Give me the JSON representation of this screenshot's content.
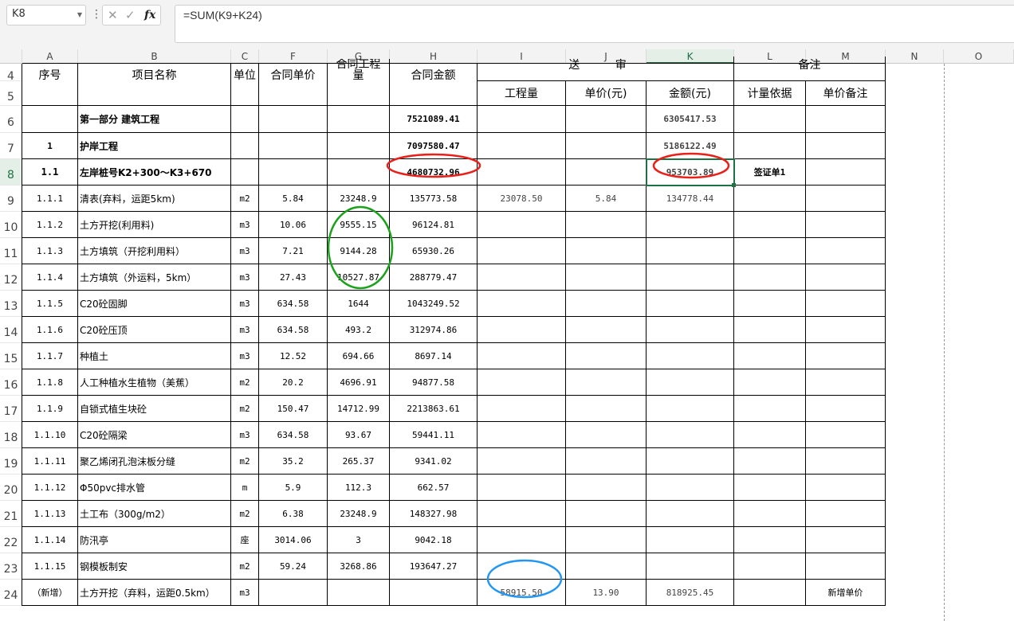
{
  "name_box": "K8",
  "formula": "=SUM(K9+K24)",
  "columns": [
    "A",
    "B",
    "C",
    "F",
    "G",
    "H",
    "I",
    "J",
    "K",
    "L",
    "M",
    "N",
    "O"
  ],
  "row_numbers": [
    "4",
    "5",
    "6",
    "7",
    "8",
    "9",
    "10",
    "11",
    "12",
    "13",
    "14",
    "15",
    "16",
    "17",
    "18",
    "19",
    "20",
    "21",
    "22",
    "23",
    "24"
  ],
  "header": {
    "seq": "序号",
    "name": "项目名称",
    "unit": "单位",
    "contract_price": "合同单价",
    "contract_qty": "合同工程量",
    "contract_amount": "合同金额",
    "group_mid": "送 审",
    "group_note": "备注",
    "qty": "工程量",
    "price": "单价(元)",
    "amount": "金额(元)",
    "basis": "计量依据",
    "price_note": "单价备注"
  },
  "rows": [
    {
      "seq": "",
      "name": "第一部分 建筑工程",
      "unit": "",
      "f": "",
      "g": "",
      "h": "7521089.41",
      "i": "",
      "j": "",
      "k": "6305417.53",
      "l": "",
      "m": ""
    },
    {
      "seq": "1",
      "name": "护岸工程",
      "unit": "",
      "f": "",
      "g": "",
      "h": "7097580.47",
      "i": "",
      "j": "",
      "k": "5186122.49",
      "l": "",
      "m": ""
    },
    {
      "seq": "1.1",
      "name": "左岸桩号K2+300～K3+670",
      "unit": "",
      "f": "",
      "g": "",
      "h": "4680732.96",
      "i": "",
      "j": "",
      "k": "953703.89",
      "l": "签证单1",
      "m": ""
    },
    {
      "seq": "1.1.1",
      "name": "清表(弃料，运距5km)",
      "unit": "m2",
      "f": "5.84",
      "g": "23248.9",
      "h": "135773.58",
      "i": "23078.50",
      "j": "5.84",
      "k": "134778.44",
      "l": "",
      "m": ""
    },
    {
      "seq": "1.1.2",
      "name": "土方开挖(利用料)",
      "unit": "m3",
      "f": "10.06",
      "g": "9555.15",
      "h": "96124.81",
      "i": "",
      "j": "",
      "k": "",
      "l": "",
      "m": ""
    },
    {
      "seq": "1.1.3",
      "name": "土方填筑（开挖利用料）",
      "unit": "m3",
      "f": "7.21",
      "g": "9144.28",
      "h": "65930.26",
      "i": "",
      "j": "",
      "k": "",
      "l": "",
      "m": ""
    },
    {
      "seq": "1.1.4",
      "name": "土方填筑（外运料，5km）",
      "unit": "m3",
      "f": "27.43",
      "g": "10527.87",
      "h": "288779.47",
      "i": "",
      "j": "",
      "k": "",
      "l": "",
      "m": ""
    },
    {
      "seq": "1.1.5",
      "name": "C20砼固脚",
      "unit": "m3",
      "f": "634.58",
      "g": "1644",
      "h": "1043249.52",
      "i": "",
      "j": "",
      "k": "",
      "l": "",
      "m": ""
    },
    {
      "seq": "1.1.6",
      "name": "C20砼压顶",
      "unit": "m3",
      "f": "634.58",
      "g": "493.2",
      "h": "312974.86",
      "i": "",
      "j": "",
      "k": "",
      "l": "",
      "m": ""
    },
    {
      "seq": "1.1.7",
      "name": "种植土",
      "unit": "m3",
      "f": "12.52",
      "g": "694.66",
      "h": "8697.14",
      "i": "",
      "j": "",
      "k": "",
      "l": "",
      "m": ""
    },
    {
      "seq": "1.1.8",
      "name": "人工种植水生植物（美蕉）",
      "unit": "m2",
      "f": "20.2",
      "g": "4696.91",
      "h": "94877.58",
      "i": "",
      "j": "",
      "k": "",
      "l": "",
      "m": ""
    },
    {
      "seq": "1.1.9",
      "name": "自锁式植生块砼",
      "unit": "m2",
      "f": "150.47",
      "g": "14712.99",
      "h": "2213863.61",
      "i": "",
      "j": "",
      "k": "",
      "l": "",
      "m": ""
    },
    {
      "seq": "1.1.10",
      "name": "C20砼隔梁",
      "unit": "m3",
      "f": "634.58",
      "g": "93.67",
      "h": "59441.11",
      "i": "",
      "j": "",
      "k": "",
      "l": "",
      "m": ""
    },
    {
      "seq": "1.1.11",
      "name": "聚乙烯闭孔泡沫板分缝",
      "unit": "m2",
      "f": "35.2",
      "g": "265.37",
      "h": "9341.02",
      "i": "",
      "j": "",
      "k": "",
      "l": "",
      "m": ""
    },
    {
      "seq": "1.1.12",
      "name": "Φ50pvc排水管",
      "unit": "m",
      "f": "5.9",
      "g": "112.3",
      "h": "662.57",
      "i": "",
      "j": "",
      "k": "",
      "l": "",
      "m": ""
    },
    {
      "seq": "1.1.13",
      "name": "土工布（300g/m2）",
      "unit": "m2",
      "f": "6.38",
      "g": "23248.9",
      "h": "148327.98",
      "i": "",
      "j": "",
      "k": "",
      "l": "",
      "m": ""
    },
    {
      "seq": "1.1.14",
      "name": "防汛亭",
      "unit": "座",
      "f": "3014.06",
      "g": "3",
      "h": "9042.18",
      "i": "",
      "j": "",
      "k": "",
      "l": "",
      "m": ""
    },
    {
      "seq": "1.1.15",
      "name": "钢模板制安",
      "unit": "m2",
      "f": "59.24",
      "g": "3268.86",
      "h": "193647.27",
      "i": "",
      "j": "",
      "k": "",
      "l": "",
      "m": ""
    },
    {
      "seq": "（新增）",
      "name": "土方开挖（弃料，运距0.5km）",
      "unit": "m3",
      "f": "",
      "g": "",
      "h": "",
      "i": "58915.50",
      "j": "13.90",
      "k": "818925.45",
      "l": "",
      "m": "新增单价"
    }
  ],
  "colors": {
    "selection": "#1e7145",
    "red_annotation": "#e8201a",
    "green_annotation": "#1ba21b",
    "blue_annotation": "#2196f3"
  }
}
